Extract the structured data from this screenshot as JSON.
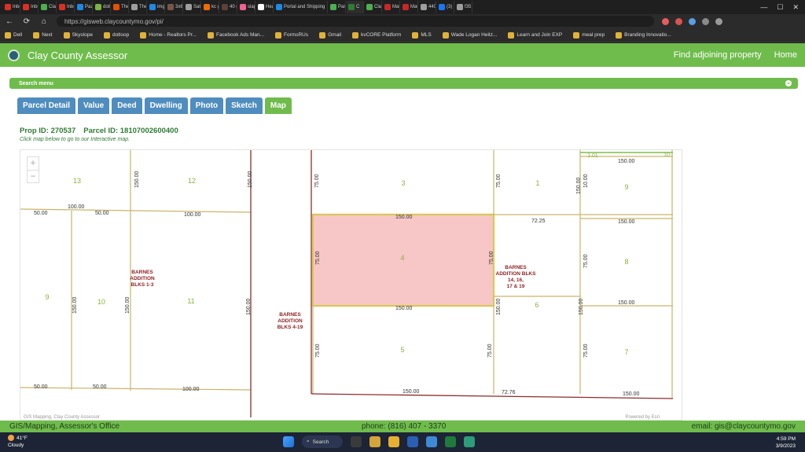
{
  "browser": {
    "tabs": [
      "Inbo",
      "Inbo",
      "Clay",
      "Inbo",
      "Pazo",
      "dotlo",
      "The",
      "Them",
      "imgu",
      "3x6",
      "Sato",
      "kc g",
      "40 gi",
      "slap",
      "Hear",
      "Portal and Shipping",
      "Parc",
      "C",
      "Clay",
      "Matr",
      "Matr",
      "4401",
      "(3) D",
      "f35 ju"
    ],
    "url": "https://gisweb.claycountymo.gov/pi/",
    "bookmarks": [
      "Dell",
      "Next",
      "Skyslope",
      "dotloop",
      "Home - Realtors Pr...",
      "Facebook Ads Man...",
      "FormsRUs",
      "Gmail",
      "kvCORE Platform",
      "MLS",
      "Wade Logan Heitz...",
      "Learn and Join EXP",
      "meal prep",
      "Branding Innovatio..."
    ]
  },
  "site": {
    "title": "Clay County Assessor",
    "links": [
      "Find adjoining property",
      "Home"
    ],
    "search_menu": "Search menu",
    "tabs": [
      "Parcel Detail",
      "Value",
      "Deed",
      "Dwelling",
      "Photo",
      "Sketch",
      "Map"
    ],
    "active_tab": "Map",
    "prop_id": "Prop ID: 270537",
    "parcel_id": "Parcel ID: 18107002600400",
    "hint": "Click map below to go to our Interactive map."
  },
  "map": {
    "zoom_in": "+",
    "zoom_out": "−",
    "attribution": "GIS Mapping, Clay County Assessor",
    "powered": "Powered by Esri",
    "highlight_color": "#f7c6c6",
    "labels": {
      "lot_13": "13",
      "lot_12": "12",
      "lot_3": "3",
      "lot_1": "1",
      "lot_9_right": "9",
      "lot_4": "4",
      "lot_8": "8",
      "lot_9_left": "9",
      "lot_10": "10",
      "lot_11": "11",
      "lot_6": "6",
      "lot_5": "5",
      "lot_7": "7",
      "addition_1_3": "BARNES|ADDITION|BLKS 1-3",
      "addition_4_19": "BARNES|ADDITION|BLKS 4-19",
      "addition_14": "BARNES|ADDITION BLKS|14, 16,|17 & 19",
      "dim_101": "1.01",
      "dim_10": "10"
    }
  },
  "footer": {
    "left": "GIS/Mapping, Assessor's Office",
    "phone": "phone: (816) 407 - 3370",
    "email": "email: gis@claycountymo.gov"
  },
  "taskbar": {
    "temp": "41°F",
    "weather": "Cloudy",
    "search": "Search",
    "time": "4:59 PM",
    "date": "3/9/2023"
  }
}
